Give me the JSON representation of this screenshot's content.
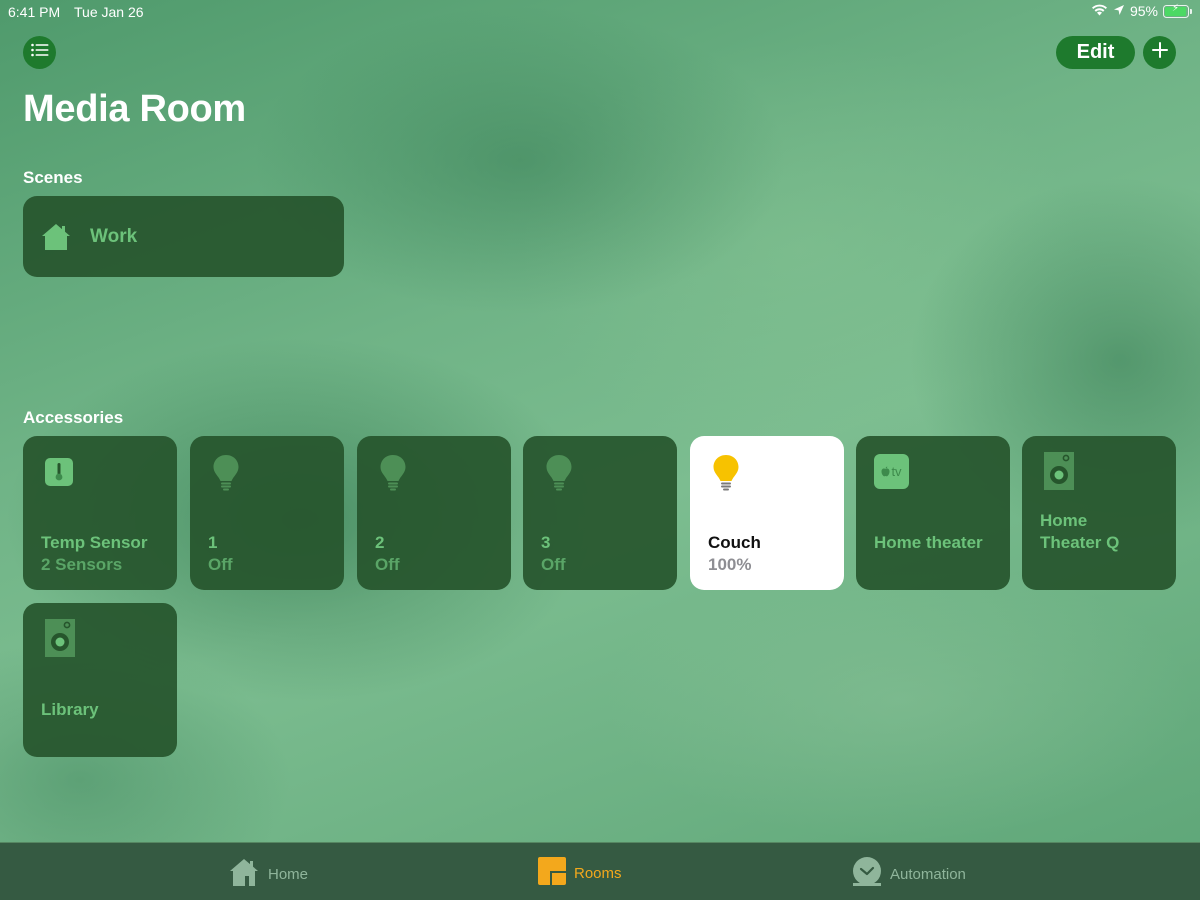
{
  "status_bar": {
    "time": "6:41 PM",
    "date": "Tue Jan 26",
    "battery_percent": "95%",
    "battery_level": 0.95,
    "charging": true,
    "icons": [
      "wifi-icon",
      "location-arrow-icon",
      "battery-icon"
    ]
  },
  "header": {
    "menu_icon": "list-icon",
    "edit_label": "Edit",
    "add_icon": "plus-icon",
    "title": "Media Room"
  },
  "scenes": {
    "label": "Scenes",
    "items": [
      {
        "label": "Work",
        "icon": "house-icon"
      }
    ]
  },
  "accessories": {
    "label": "Accessories",
    "items": [
      {
        "name": "Temp Sensor",
        "status": "2 Sensors",
        "icon": "thermometer-icon",
        "on": false
      },
      {
        "name": "1",
        "status": "Off",
        "icon": "lightbulb-icon",
        "on": false
      },
      {
        "name": "2",
        "status": "Off",
        "icon": "lightbulb-icon",
        "on": false
      },
      {
        "name": "3",
        "status": "Off",
        "icon": "lightbulb-icon",
        "on": false
      },
      {
        "name": "Couch",
        "status": "100%",
        "icon": "lightbulb-icon",
        "on": true
      },
      {
        "name": "Home theater",
        "status": "",
        "icon": "apple-tv-icon",
        "apple_tv_text": "tv",
        "on": false
      },
      {
        "name": "Home Theater Q",
        "status": "",
        "icon": "speaker-icon",
        "on": false
      },
      {
        "name": "Library",
        "status": "",
        "icon": "speaker-icon",
        "on": false
      }
    ]
  },
  "tab_bar": {
    "tabs": [
      {
        "label": "Home",
        "icon": "house-icon",
        "active": false
      },
      {
        "label": "Rooms",
        "icon": "rooms-icon",
        "active": true
      },
      {
        "label": "Automation",
        "icon": "clock-check-icon",
        "active": false
      }
    ]
  },
  "colors": {
    "accent_green": "#1e7a2d",
    "tile_bg": "#26552c",
    "tile_text": "#6cc27a",
    "bulb_on": "#f7c200",
    "active_tab": "#f3a81c"
  }
}
